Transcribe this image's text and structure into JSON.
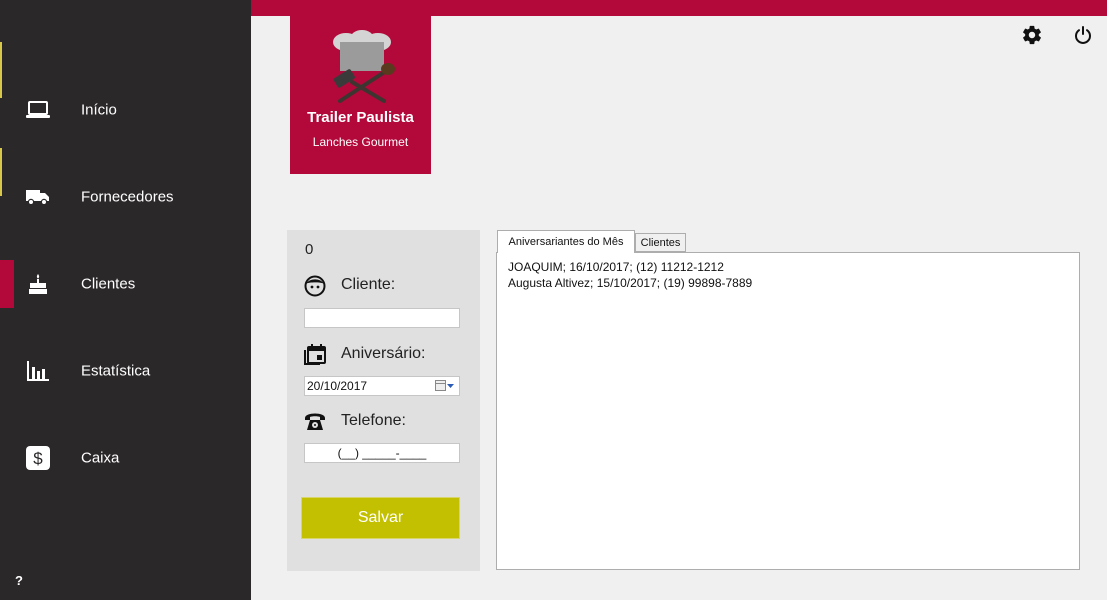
{
  "sidebar": {
    "items": [
      {
        "label": "Início",
        "icon": "laptop-icon"
      },
      {
        "label": "Fornecedores",
        "icon": "truck-icon"
      },
      {
        "label": "Clientes",
        "icon": "cake-icon",
        "active": true
      },
      {
        "label": "Estatística",
        "icon": "bar-chart-icon"
      },
      {
        "label": "Caixa",
        "icon": "dollar-icon"
      }
    ],
    "help_label": "?"
  },
  "header": {
    "settings_icon": "gear-icon",
    "power_icon": "power-icon"
  },
  "logo": {
    "title": "Trailer Paulista",
    "subtitle": "Lanches Gourmet"
  },
  "form": {
    "counter": "0",
    "client_label": "Cliente:",
    "client_value": "",
    "birthday_label": "Aniversário:",
    "birthday_value": "20/10/2017",
    "phone_label": "Telefone:",
    "phone_value": "(__) _____-____",
    "save_label": "Salvar"
  },
  "tabs": [
    {
      "label": "Aniversariantes do Mês",
      "active": true
    },
    {
      "label": "Clientes",
      "active": false
    }
  ],
  "birthday_list": [
    "JOAQUIM; 16/10/2017; (12) 11212-1212",
    "Augusta Altivez; 15/10/2017; (19) 99898-7889"
  ],
  "colors": {
    "brand": "#b3093a",
    "sidebar_bg": "#2b2829",
    "save_button": "#c2c000",
    "background": "#f0f0f0"
  }
}
